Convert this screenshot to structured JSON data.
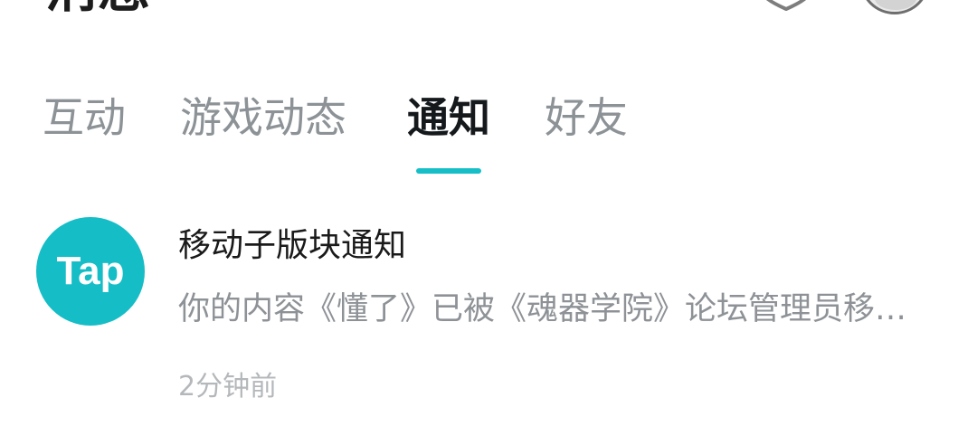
{
  "header": {
    "title": "消息",
    "icons": [
      "shield-icon"
    ],
    "avatar": "user-avatar"
  },
  "tabs": [
    {
      "label": "互动",
      "active": false
    },
    {
      "label": "游戏动态",
      "active": false
    },
    {
      "label": "通知",
      "active": true
    },
    {
      "label": "好友",
      "active": false
    }
  ],
  "colors": {
    "accent": "#16bfc8",
    "tab_inactive": "#8c9296",
    "tab_active": "#15191c"
  },
  "notification": {
    "logo_text": "Tap",
    "title": "移动子版块通知",
    "body": "你的内容《懂了》已被《魂器学院》论坛管理员移动子版块",
    "time": "2分钟前"
  }
}
